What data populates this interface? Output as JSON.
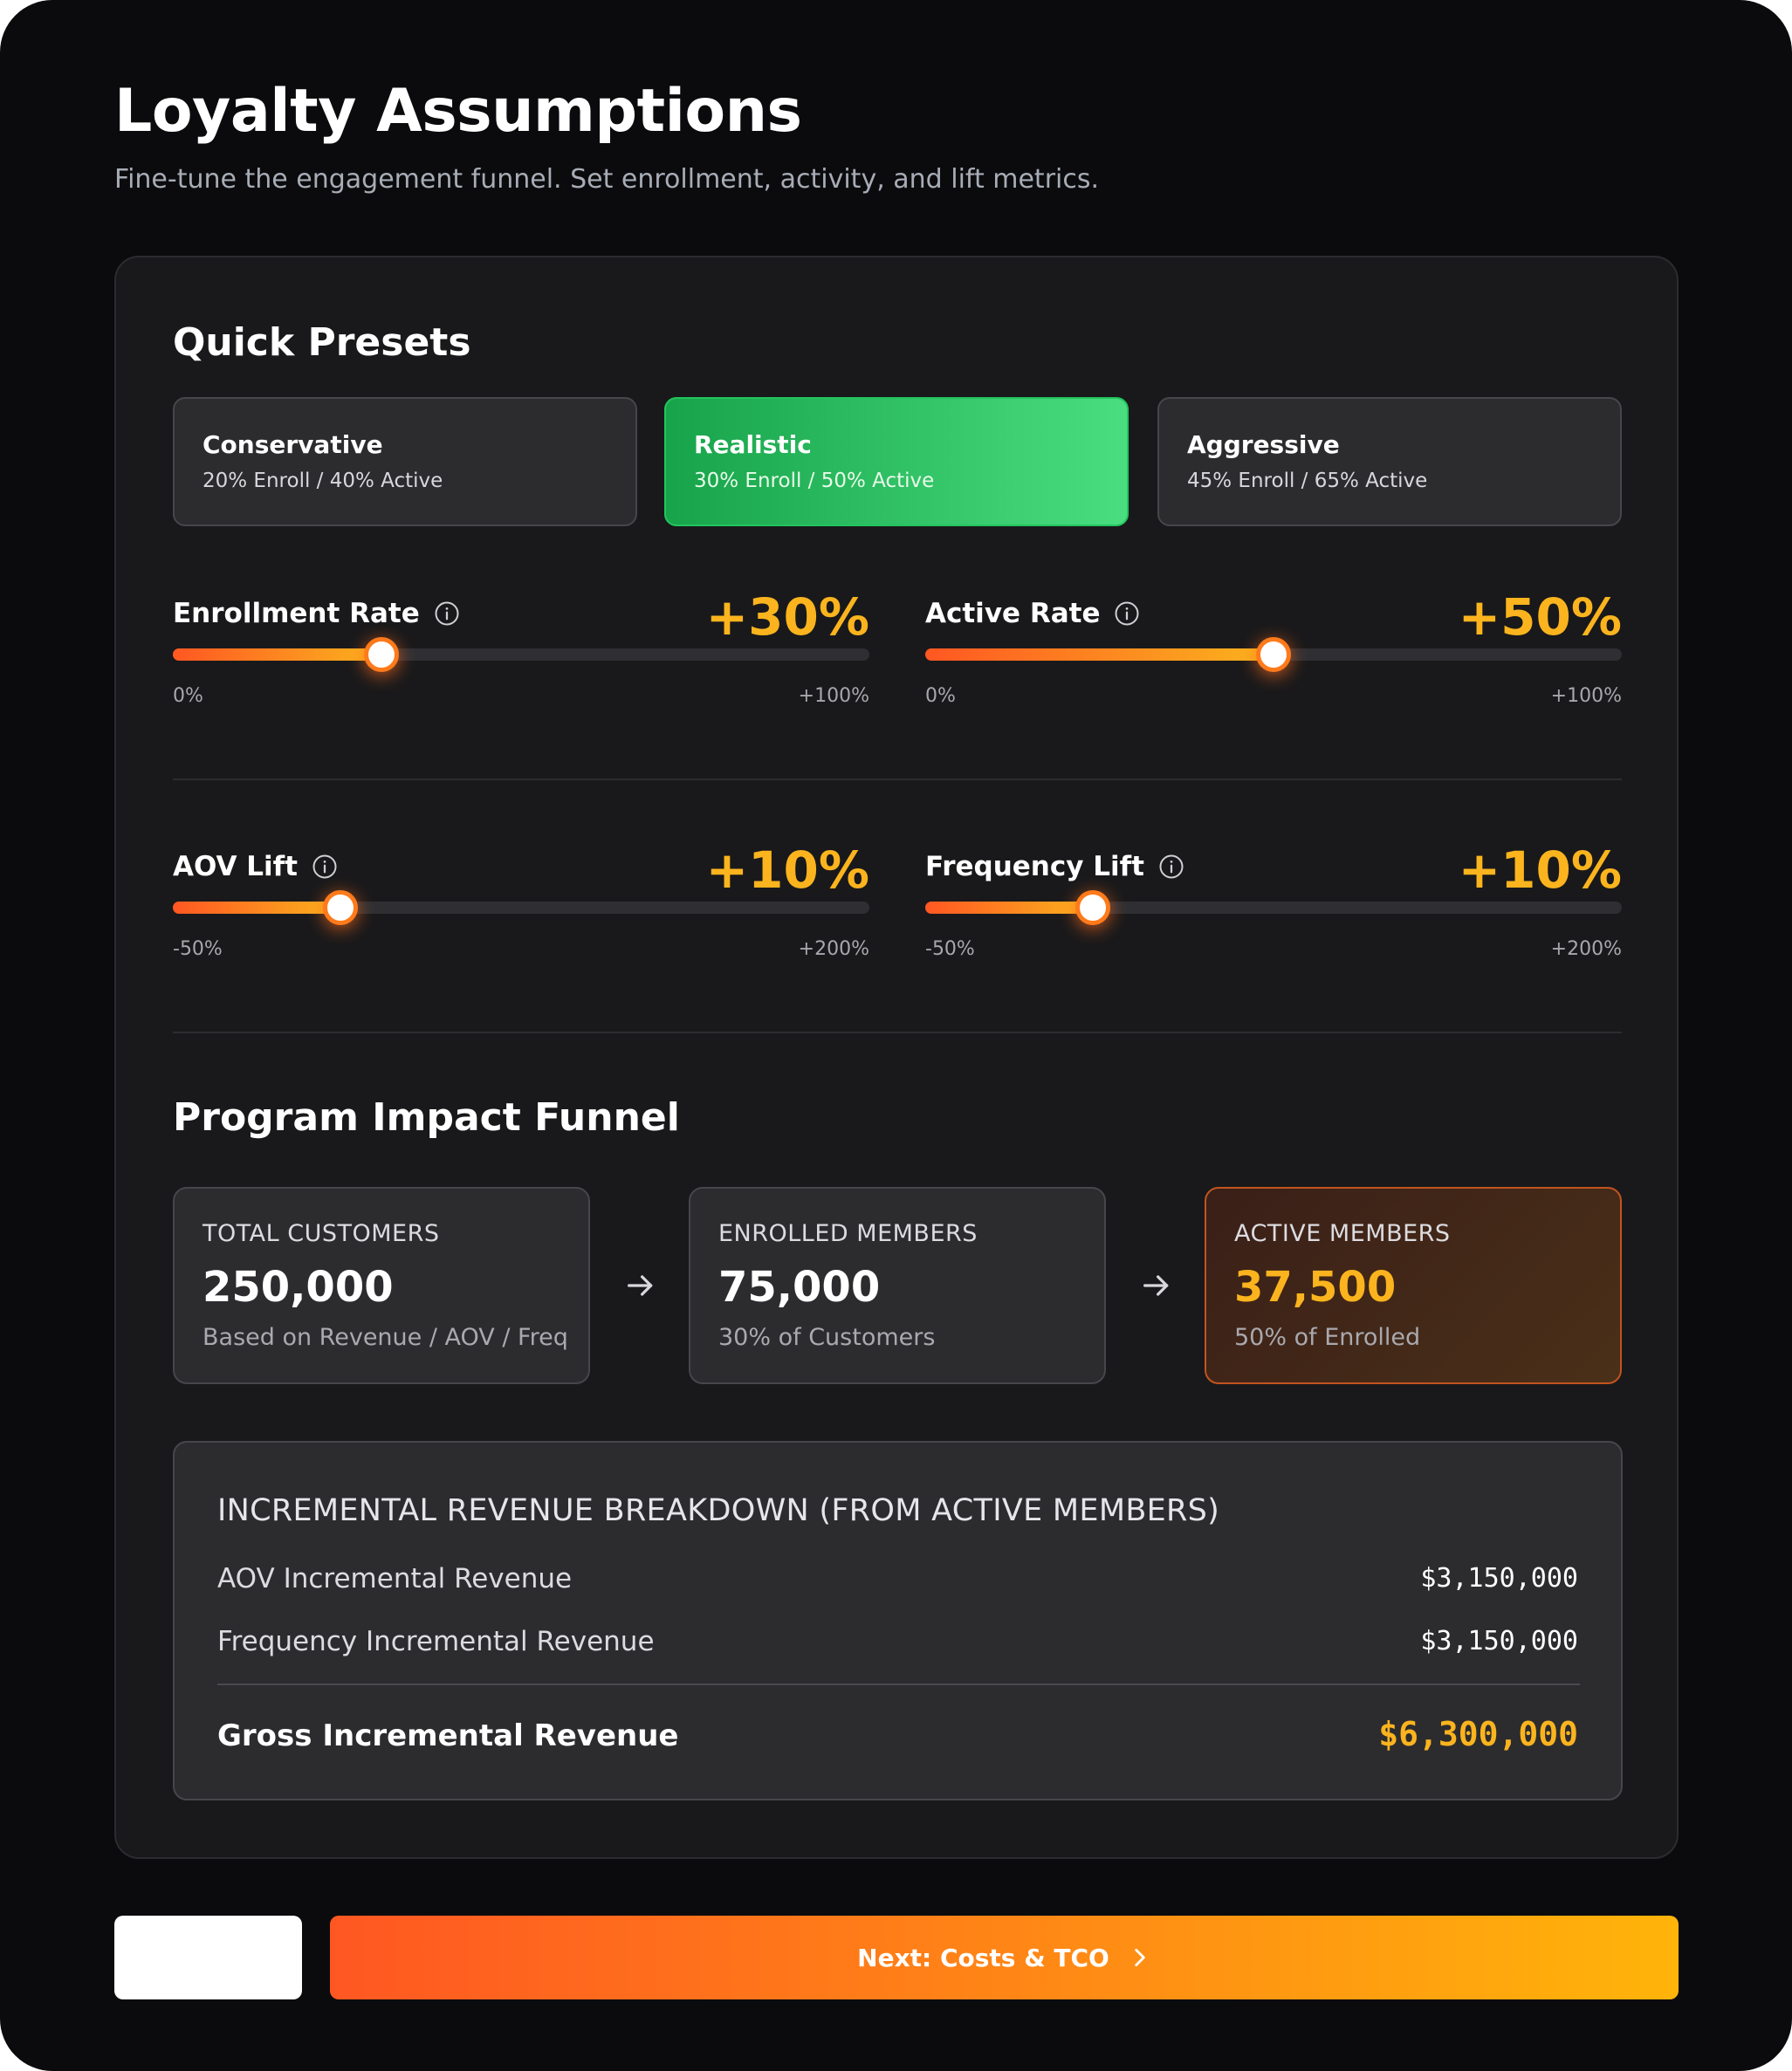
{
  "header": {
    "title": "Loyalty Assumptions",
    "subtitle": "Fine-tune the engagement funnel. Set enrollment, activity, and lift metrics."
  },
  "presets": {
    "title": "Quick Presets",
    "selected": "Realistic",
    "items": [
      {
        "label": "Conservative",
        "description": "20% Enroll / 40% Active"
      },
      {
        "label": "Realistic",
        "description": "30% Enroll / 50% Active"
      },
      {
        "label": "Aggressive",
        "description": "45% Enroll / 65% Active"
      }
    ]
  },
  "sliders": {
    "enrollment": {
      "label": "Enrollment Rate",
      "display": "+30%",
      "value": 30,
      "min": 0,
      "max": 100,
      "min_label": "0%",
      "max_label": "+100%"
    },
    "active": {
      "label": "Active Rate",
      "display": "+50%",
      "value": 50,
      "min": 0,
      "max": 100,
      "min_label": "0%",
      "max_label": "+100%"
    },
    "aov": {
      "label": "AOV Lift",
      "display": "+10%",
      "value": 10,
      "min": -50,
      "max": 200,
      "min_label": "-50%",
      "max_label": "+200%"
    },
    "frequency": {
      "label": "Frequency Lift",
      "display": "+10%",
      "value": 10,
      "min": -50,
      "max": 200,
      "min_label": "-50%",
      "max_label": "+200%"
    }
  },
  "funnel": {
    "title": "Program Impact Funnel",
    "total": {
      "label": "TOTAL CUSTOMERS",
      "value": "250,000",
      "sub": "Based on Revenue / AOV / Freq"
    },
    "enrolled": {
      "label": "ENROLLED MEMBERS",
      "value": "75,000",
      "sub": "30% of Customers"
    },
    "active": {
      "label": "ACTIVE MEMBERS",
      "value": "37,500",
      "sub": "50% of Enrolled"
    }
  },
  "breakdown": {
    "title": "INCREMENTAL REVENUE BREAKDOWN (FROM ACTIVE MEMBERS)",
    "aov_label": "AOV Incremental Revenue",
    "aov_value": "$3,150,000",
    "freq_label": "Frequency Incremental Revenue",
    "freq_value": "$3,150,000",
    "total_label": "Gross Incremental Revenue",
    "total_value": "$6,300,000"
  },
  "footer": {
    "back_label": "",
    "next_label": "Next: Costs & TCO"
  },
  "icons": {
    "info": "info-circle-icon",
    "arrow": "arrow-right-icon",
    "chevron": "chevron-right-icon"
  },
  "colors": {
    "accent": "#fbb41e",
    "accent_orange": "#ff5722",
    "preset_active": "#22c55e",
    "background": "#0b0b0d",
    "card": "#19191b"
  }
}
